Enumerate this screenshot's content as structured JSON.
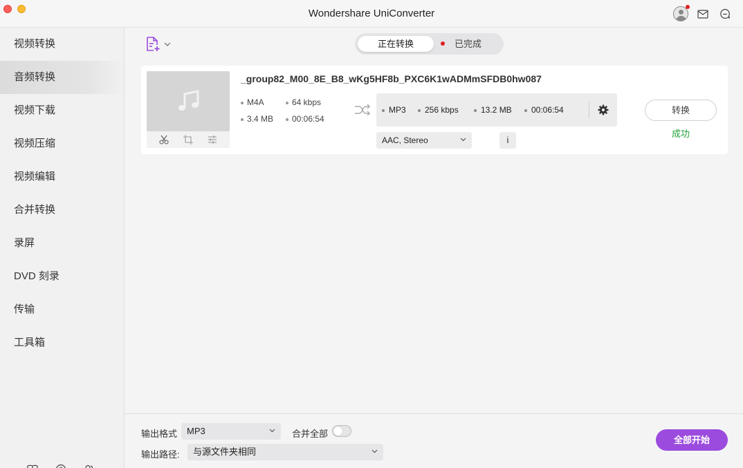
{
  "window": {
    "title": "Wondershare UniConverter"
  },
  "sidebar": {
    "items": [
      {
        "label": "视频转换"
      },
      {
        "label": "音频转换",
        "active": true
      },
      {
        "label": "视频下载"
      },
      {
        "label": "视频压缩"
      },
      {
        "label": "视频编辑"
      },
      {
        "label": "合并转换"
      },
      {
        "label": "录屏"
      },
      {
        "label": "DVD 刻录"
      },
      {
        "label": "传输"
      },
      {
        "label": "工具箱"
      }
    ],
    "bottom_icons": [
      "book-icon",
      "help-icon",
      "users-icon"
    ]
  },
  "tabs": {
    "converting": "正在转换",
    "finished": "已完成",
    "finished_has_badge": true
  },
  "task": {
    "file_name": "_group82_M00_8E_B8_wKg5HF8b_PXC6K1wADMmSFDB0hw087",
    "source": {
      "format": "M4A",
      "bitrate": "64 kbps",
      "size": "3.4 MB",
      "duration": "00:06:54"
    },
    "output": {
      "format": "MP3",
      "bitrate": "256 kbps",
      "size": "13.2 MB",
      "duration": "00:06:54"
    },
    "audio_track": "AAC, Stereo",
    "info_label": "i",
    "convert_label": "转换",
    "status": "成功"
  },
  "footer": {
    "output_format_label": "输出格式",
    "output_format_value": "MP3",
    "merge_all_label": "合并全部",
    "merge_all_on": false,
    "output_path_label": "输出路径:",
    "output_path_value": "与源文件夹相同",
    "start_all_label": "全部开始"
  },
  "colors": {
    "accent": "#9b4bdd",
    "success": "#23a23a",
    "badge": "#e02020"
  }
}
